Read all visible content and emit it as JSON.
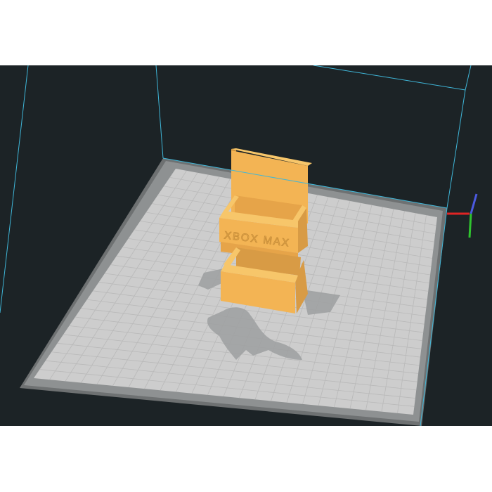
{
  "viewport": {
    "background": "#1c2326",
    "build_volume_edge_color": "#3fb6d8"
  },
  "build_plate": {
    "outer_color": "#6e7172",
    "border_color": "#8f9293",
    "surface_color": "#cdcdcd",
    "grid_color": "#b9b9b9"
  },
  "model": {
    "color": "#f3b454",
    "embossed_text": "XBOX MAX"
  },
  "axis_gizmo": {
    "x_color": "#e02424",
    "y_color": "#2fc42f",
    "z_color": "#4b5ae0"
  }
}
